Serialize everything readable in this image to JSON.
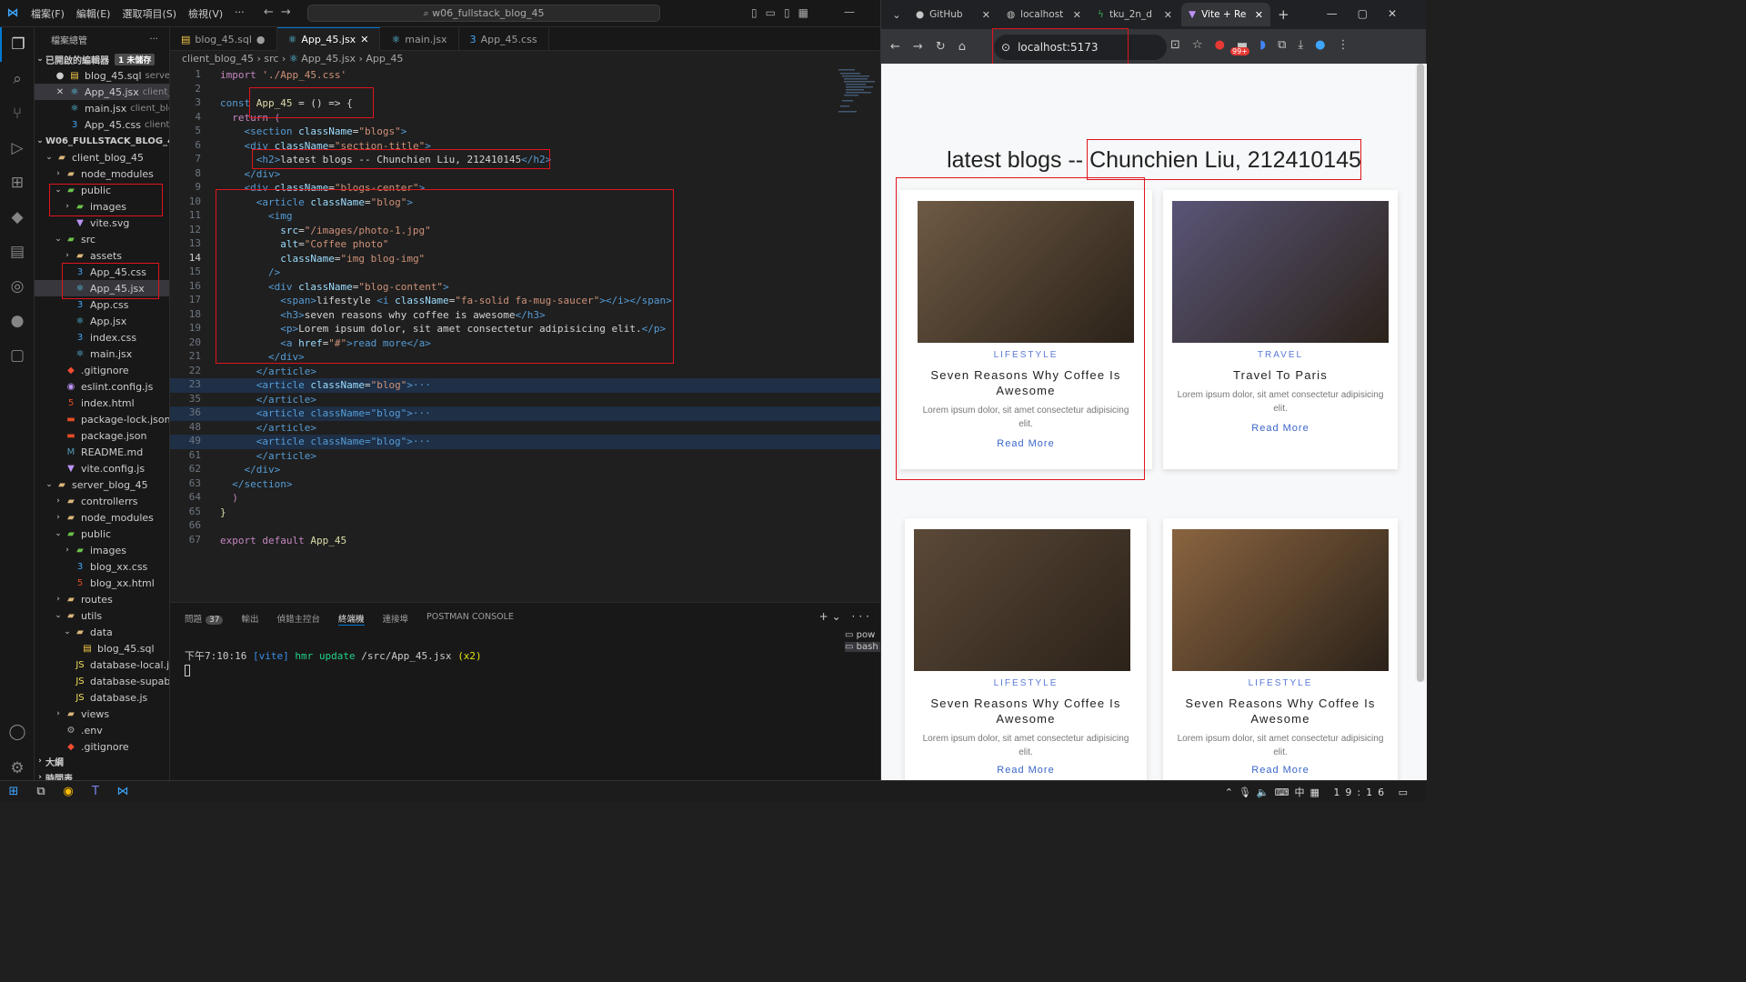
{
  "vscode": {
    "menu": [
      "檔案(F)",
      "編輯(E)",
      "選取項目(S)",
      "檢視(V)",
      "···"
    ],
    "search": "w06_fullstack_blog_45",
    "sidebar_title": "檔案總管",
    "open_editors": {
      "label": "已開啟的編輯器",
      "badge": "1 未儲存",
      "files": [
        {
          "name": "blog_45.sql",
          "desc": "server_..."
        },
        {
          "name": "App_45.jsx",
          "desc": "client_b..."
        },
        {
          "name": "main.jsx",
          "desc": "client_blo..."
        },
        {
          "name": "App_45.css",
          "desc": "client_..."
        }
      ]
    },
    "project": "W06_FULLSTACK_BLOG_45",
    "tree": [
      "client_blog_45",
      "node_modules",
      "public",
      "images",
      "vite.svg",
      "src",
      "assets",
      "App_45.css",
      "App_45.jsx",
      "App.css",
      "App.jsx",
      "index.css",
      "main.jsx",
      ".gitignore",
      "eslint.config.js",
      "index.html",
      "package-lock.json",
      "package.json",
      "README.md",
      "vite.config.js",
      "server_blog_45",
      "controllerrs",
      "node_modules",
      "public",
      "images",
      "blog_xx.css",
      "blog_xx.html",
      "routes",
      "utils",
      "data",
      "blog_45.sql",
      "database-local.js",
      "database-supaba...",
      "database.js",
      "views",
      ".env",
      ".gitignore"
    ],
    "outline": "大綱",
    "timeline": "時間表",
    "tabs": [
      "blog_45.sql",
      "App_45.jsx",
      "main.jsx",
      "App_45.css"
    ],
    "breadcrumb": [
      "client_blog_45",
      "src",
      "App_45.jsx",
      "App_45"
    ],
    "line_numbers": [
      "1",
      "2",
      "3",
      "4",
      "5",
      "6",
      "7",
      "8",
      "9",
      "10",
      "11",
      "12",
      "13",
      "14",
      "15",
      "16",
      "17",
      "18",
      "19",
      "20",
      "21",
      "22",
      "23",
      "35",
      "36",
      "48",
      "49",
      "61",
      "62",
      "63",
      "64",
      "65",
      "66",
      "67"
    ],
    "code": {
      "l1a": "import ",
      "l1b": "'./App_45.css'",
      "l3a": "const ",
      "l3b": "App_45",
      "l3c": " = () => {",
      "l4": "  return (",
      "l5a": "    <",
      "l5b": "section ",
      "l5c": "className",
      "l5d": "=",
      "l5e": "\"blogs\"",
      "l5f": ">",
      "l6a": "    <",
      "l6b": "div ",
      "l6c": "className",
      "l6d": "=",
      "l6e": "\"section-title\"",
      "l6f": ">",
      "l7a": "      <h2>",
      "l7b": "latest blogs -- Chunchien Liu, 212410145",
      "l7c": "</h2>",
      "l8": "    </div>",
      "l9a": "    <",
      "l9b": "div ",
      "l9c": "className",
      "l9d": "=",
      "l9e": "\"blogs-center\"",
      "l9f": ">",
      "l10a": "      <",
      "l10b": "article ",
      "l10c": "className",
      "l10d": "=",
      "l10e": "\"blog\"",
      "l10f": ">",
      "l11": "        <img",
      "l12a": "          src",
      "l12b": "=",
      "l12c": "\"/images/photo-1.jpg\"",
      "l13a": "          alt",
      "l13b": "=",
      "l13c": "\"Coffee photo\"",
      "l14a": "          className",
      "l14b": "=",
      "l14c": "\"img blog-img\"",
      "l15": "        />",
      "l16a": "        <",
      "l16b": "div ",
      "l16c": "className",
      "l16d": "=",
      "l16e": "\"blog-content\"",
      "l16f": ">",
      "l17a": "          <span>",
      "l17b": "lifestyle ",
      "l17c": "<i ",
      "l17d": "className",
      "l17e": "=",
      "l17f": "\"fa-solid fa-mug-saucer\"",
      "l17g": "></i></span>",
      "l18a": "          <h3>",
      "l18b": "seven reasons why coffee is awesome",
      "l18c": "</h3>",
      "l19a": "          <p>",
      "l19b": "Lorem ipsum dolor, sit amet consectetur adipisicing elit.",
      "l19c": "</p>",
      "l20a": "          <a ",
      "l20b": "href",
      "l20c": "=",
      "l20d": "\"#\"",
      "l20e": ">read more</a>",
      "l21": "        </div>",
      "l22": "      </article>",
      "l23a": "      <",
      "l23b": "article ",
      "l23c": "className",
      "l23d": "=",
      "l23e": "\"blog\"",
      "l23f": ">···",
      "l35": "      </article>",
      "l36": "      <article className=\"blog\">···",
      "l48": "      </article>",
      "l49": "      <article className=\"blog\">···",
      "l61": "      </article>",
      "l62": "    </div>",
      "l63": "  </section>",
      "l64": "  )",
      "l65": "}",
      "l67a": "export default ",
      "l67b": "App_45"
    },
    "panel_tabs": [
      "問題",
      "輸出",
      "偵錯主控台",
      "終端機",
      "連接埠",
      "POSTMAN CONSOLE"
    ],
    "problems_count": "37",
    "terminal": {
      "time": "下午7:10:16",
      "tag": "[vite]",
      "msg": "hmr update",
      "path": "/src/App_45.jsx",
      "count": "(x2)"
    },
    "terminal_list": [
      "pow",
      "bash"
    ]
  },
  "browser": {
    "tabs": [
      "GitHub",
      "localhost",
      "tku_2n_d",
      "Vite + Re"
    ],
    "url": "localhost:5173",
    "notification_badge": "99+",
    "page_title": "latest blogs -- Chunchien Liu, 212410145",
    "cards": [
      {
        "category": "LIFESTYLE",
        "title": "Seven Reasons Why Coffee Is Awesome",
        "desc": "Lorem ipsum dolor, sit amet consectetur adipisicing elit.",
        "link": "Read More",
        "img": "#6e5a44"
      },
      {
        "category": "TRAVEL",
        "title": "Travel To Paris",
        "desc": "Lorem ipsum dolor, sit amet consectetur adipisicing elit.",
        "link": "Read More",
        "img": "#5a5577"
      },
      {
        "category": "LIFESTYLE",
        "title": "Seven Reasons Why Coffee Is Awesome",
        "desc": "Lorem ipsum dolor, sit amet consectetur adipisicing elit.",
        "link": "Read More",
        "img": "#5b4938"
      },
      {
        "category": "LIFESTYLE",
        "title": "Seven Reasons Why Coffee Is Awesome",
        "desc": "Lorem ipsum dolor, sit amet consectetur adipisicing elit.",
        "link": "Read More",
        "img": "#8a6440"
      }
    ]
  },
  "taskbar": {
    "ime": "中",
    "time": "19:16"
  }
}
